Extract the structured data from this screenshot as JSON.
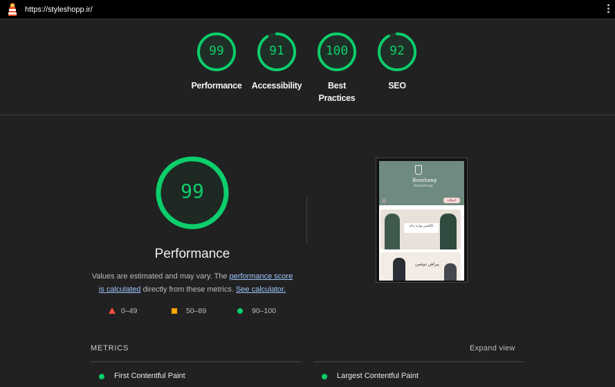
{
  "browser": {
    "url": "https://styleshopp.ir/"
  },
  "scores": [
    {
      "label": "Performance",
      "value": "99",
      "fraction": 0.99
    },
    {
      "label": "Accessibility",
      "value": "91",
      "fraction": 0.91
    },
    {
      "label": "Best Practices",
      "value": "100",
      "fraction": 1.0
    },
    {
      "label": "SEO",
      "value": "92",
      "fraction": 0.92
    }
  ],
  "performance": {
    "score": "99",
    "fraction": 0.99,
    "title": "Performance",
    "desc_prefix": "Values are estimated and may vary. The ",
    "desc_link1": "performance score is calculated",
    "desc_middle": " directly from these metrics. ",
    "desc_link2": "See calculator."
  },
  "legend": [
    {
      "range": "0–49",
      "color": "#ff4e42",
      "shape": "triangle"
    },
    {
      "range": "50–89",
      "color": "#ffa400",
      "shape": "square"
    },
    {
      "range": "90–100",
      "color": "#0cce6b",
      "shape": "circle"
    }
  ],
  "screenshot_preview": {
    "brand": "Boushang",
    "brand_sub": "Styleshopp",
    "pill": "لاتیوگان",
    "card1_title": "کالکشن بهاره زنانه",
    "card2_title": "پیراهن دوشین"
  },
  "metrics": {
    "section_label": "METRICS",
    "expand_label": "Expand view",
    "items": [
      {
        "label": "First Contentful Paint"
      },
      {
        "label": "Largest Contentful Paint"
      }
    ]
  },
  "colors": {
    "pass": "#0cce6b",
    "background": "#212121",
    "topbar": "#000000"
  }
}
